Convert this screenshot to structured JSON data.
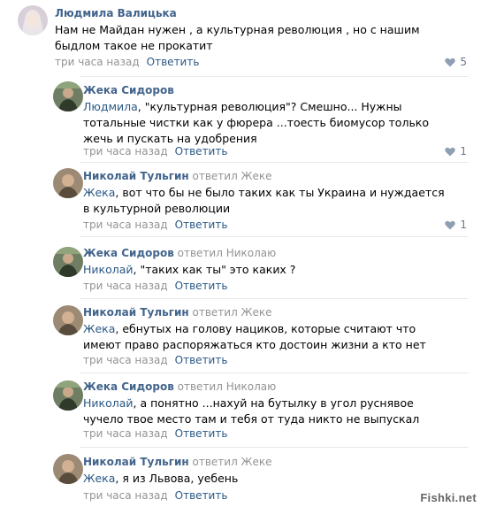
{
  "comments": [
    {
      "author": "Людмила Валицька",
      "replied": "",
      "mention": "",
      "text": "Нам не Майдан нужен , а культурная революция , но с нашим быдлом такое не прокатит",
      "time": "три часа назад",
      "reply_label": "Ответить",
      "likes": "5",
      "avatar": "woman-avatar"
    },
    {
      "author": "Жека Сидоров",
      "replied": "",
      "mention": "Людмила",
      "text": ", \"культурная революция\"? Смешно... Нужны тотальные чистки как у фюрера ...тоесть биомусор только жечь и пускать на удобрения",
      "time": "три часа назад",
      "reply_label": "Ответить",
      "likes": "1",
      "avatar": "man-avatar"
    },
    {
      "author": "Николай Тульгин",
      "replied": "ответил Жеке",
      "mention": "Жека",
      "text": ", вот что бы не было таких как ты Украина и нуждается в культурной революции",
      "time": "три часа назад",
      "reply_label": "Ответить",
      "likes": "1",
      "avatar": "man-avatar-2"
    },
    {
      "author": "Жека Сидоров",
      "replied": "ответил Николаю",
      "mention": "Николай",
      "text": ", \"таких как ты\" это каких ?",
      "time": "три часа назад",
      "reply_label": "Ответить",
      "likes": "",
      "avatar": "man-avatar"
    },
    {
      "author": "Николай Тульгин",
      "replied": "ответил Жеке",
      "mention": "Жека",
      "text": ", ебнутых на голову нациков, которые считают что имеют право распоряжаться кто достоин жизни а кто нет",
      "time": "три часа назад",
      "reply_label": "Ответить",
      "likes": "",
      "avatar": "man-avatar-2"
    },
    {
      "author": "Жека Сидоров",
      "replied": "ответил Николаю",
      "mention": "Николай",
      "text": ", а понятно ...нахуй на бутылку в угол руснявое чучело твое место там и тебя от туда никто не выпускал",
      "time": "три часа назад",
      "reply_label": "Ответить",
      "likes": "",
      "avatar": "man-avatar"
    },
    {
      "author": "Николай Тульгин",
      "replied": "ответил Жеке",
      "mention": "Жека",
      "text": ", я из Львова, уебень",
      "time": "три часа назад",
      "reply_label": "Ответить",
      "likes": "",
      "avatar": "man-avatar-2"
    }
  ],
  "watermark": "Fishki.net",
  "colors": {
    "author": "#42648b",
    "link": "#2a5885",
    "meta": "#939393",
    "divider": "#e7e8ec"
  }
}
